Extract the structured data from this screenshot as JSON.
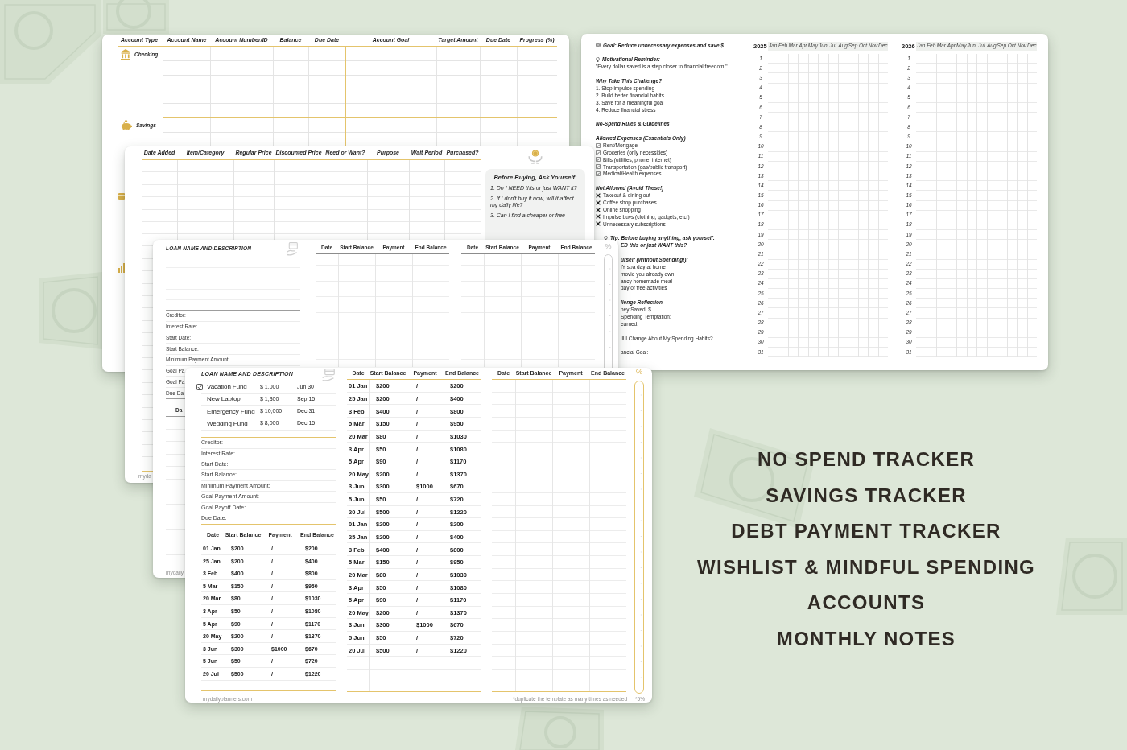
{
  "accounts_page": {
    "columns": [
      "Account Type",
      "Account Name",
      "Account Number/ID",
      "Balance",
      "Due Date",
      "Account Goal",
      "Target Amount",
      "Due Date",
      "Progress (%)"
    ],
    "account_types": [
      {
        "label": "Checking"
      },
      {
        "label": "Savings"
      }
    ]
  },
  "no_spend_page": {
    "notes": [
      [
        {
          "kind": "goal",
          "text": "Goal: Reduce unnecessary expenses and save $"
        }
      ],
      [
        {
          "kind": "reminder",
          "text": "Motivational Reminder:"
        },
        {
          "kind": "text",
          "text": "\"Every dollar saved is a step closer to financial freedom.\""
        }
      ],
      [
        {
          "kind": "heading",
          "text": "Why Take This Challenge?"
        },
        {
          "kind": "text",
          "text": "1. Stop impulse spending"
        },
        {
          "kind": "text",
          "text": "2. Build better financial habits"
        },
        {
          "kind": "text",
          "text": "3. Save for a meaningful goal"
        },
        {
          "kind": "text",
          "text": "4. Reduce financial stress"
        }
      ],
      [
        {
          "kind": "heading",
          "text": "No-Spend Rules & Guidelines"
        }
      ],
      [
        {
          "kind": "heading",
          "text": "Allowed Expenses (Essentials Only)"
        },
        {
          "kind": "allowed",
          "text": "Rent/Mortgage"
        },
        {
          "kind": "allowed",
          "text": "Groceries (only necessities)"
        },
        {
          "kind": "allowed",
          "text": "Bills (utilities, phone, internet)"
        },
        {
          "kind": "allowed",
          "text": "Transportation (gas/public transport)"
        },
        {
          "kind": "allowed",
          "text": "Medical/Health expenses"
        }
      ],
      [
        {
          "kind": "heading",
          "text": "Not Allowed (Avoid These!)"
        },
        {
          "kind": "banned",
          "text": "Takeout & dining out"
        },
        {
          "kind": "banned",
          "text": "Coffee shop purchases"
        },
        {
          "kind": "banned",
          "text": "Online shopping"
        },
        {
          "kind": "banned",
          "text": "Impulse buys (clothing, gadgets, etc.)"
        },
        {
          "kind": "banned",
          "text": "Unnecessary subscriptions"
        }
      ],
      [
        {
          "kind": "tip",
          "text": "Tip: Before buying anything, ask yourself:"
        }
      ]
    ],
    "notes_partly_covered": [
      [
        {
          "kind": "heading",
          "text": "ED this or just WANT this?"
        }
      ],
      [
        {
          "kind": "heading",
          "text": "urself (Without Spending!):"
        },
        {
          "kind": "text",
          "text": "IY spa day at home"
        },
        {
          "kind": "text",
          "text": "movie you already own"
        },
        {
          "kind": "text",
          "text": "ancy homemade meal"
        },
        {
          "kind": "text",
          "text": "day of free activities"
        }
      ],
      [
        {
          "kind": "heading",
          "text": "llenge Reflection"
        },
        {
          "kind": "text",
          "text": "ney Saved: $"
        },
        {
          "kind": "text",
          "text": "Spending Temptation:"
        },
        {
          "kind": "text",
          "text": "earned:"
        }
      ],
      [
        {
          "kind": "text",
          "text": "ill I Change About My Spending Habits?"
        }
      ],
      [
        {
          "kind": "text",
          "text": "ancial Goal:"
        }
      ]
    ],
    "trackers": [
      {
        "year": "2025",
        "months": [
          "Jan",
          "Feb",
          "Mar",
          "Apr",
          "May",
          "Jun",
          "Jul",
          "Aug",
          "Sep",
          "Oct",
          "Nov",
          "Dec"
        ],
        "days": [
          "1",
          "2",
          "3",
          "4",
          "5",
          "6",
          "7",
          "8",
          "9",
          "10",
          "11",
          "12",
          "13",
          "14",
          "15",
          "16",
          "17",
          "18",
          "19",
          "20",
          "21",
          "22",
          "23",
          "24",
          "25",
          "26",
          "27",
          "28",
          "29",
          "30",
          "31"
        ]
      },
      {
        "year": "2026",
        "months": [
          "Jan",
          "Feb",
          "Mar",
          "Apr",
          "May",
          "Jun",
          "Jul",
          "Aug",
          "Sep",
          "Oct",
          "Nov",
          "Dec"
        ],
        "days": [
          "1",
          "2",
          "3",
          "4",
          "5",
          "6",
          "7",
          "8",
          "9",
          "10",
          "11",
          "12",
          "13",
          "14",
          "15",
          "16",
          "17",
          "18",
          "19",
          "20",
          "21",
          "22",
          "23",
          "24",
          "25",
          "26",
          "27",
          "28",
          "29",
          "30",
          "31"
        ]
      }
    ]
  },
  "wishlist_page": {
    "columns": [
      "Date Added",
      "Item/Category",
      "Regular Price",
      "Discounted Price",
      "Need or Want?",
      "Purpose",
      "Wait Period",
      "Purchased?"
    ],
    "reminder_card": {
      "title": "Before Buying, Ask Yourself:",
      "questions": [
        "1. Do I NEED this or just WANT it?",
        "2. If I don't buy it now, will it affect my daily life?",
        "3. Can I find a cheaper or free"
      ]
    },
    "footer": "myda"
  },
  "loan_page_back": {
    "title": "LOAN NAME AND DESCRIPTION",
    "fields": [
      "Creditor:",
      "Interest Rate:",
      "Start Date:",
      "Start Balance:",
      "Minimum Payment Amount:",
      "Goal Pa",
      "Goal Pa",
      "Due Da"
    ],
    "history_columns": [
      "Da"
    ],
    "tables": [
      {
        "columns": [
          "Date",
          "Start Balance",
          "Payment",
          "End Balance"
        ]
      },
      {
        "columns": [
          "Date",
          "Start Balance",
          "Payment",
          "End Balance"
        ]
      }
    ],
    "progress_symbol": "%",
    "footer": "mydaily"
  },
  "loan_page_front": {
    "title": "LOAN NAME AND DESCRIPTION",
    "goals": [
      {
        "checked": true,
        "name": "Vacation Fund",
        "amount": "$ 1,000",
        "date": "Jun 30"
      },
      {
        "checked": false,
        "name": "New Laptop",
        "amount": "$ 1,300",
        "date": "Sep 15"
      },
      {
        "checked": false,
        "name": "Emergency Fund",
        "amount": "$ 10,000",
        "date": "Dec 31"
      },
      {
        "checked": false,
        "name": "Wedding Fund",
        "amount": "$ 8,000",
        "date": "Dec 15"
      }
    ],
    "fields": [
      "Creditor:",
      "Interest Rate:",
      "Start Date:",
      "Start Balance:",
      "Minimum Payment Amount:",
      "Goal Payment Amount:",
      "Goal Payoff Date:",
      "Due Date:"
    ],
    "history": {
      "columns": [
        "Date",
        "Start Balance",
        "Payment",
        "End Balance"
      ],
      "rows": [
        [
          "01 Jan",
          "$200",
          "/",
          "$200"
        ],
        [
          "25 Jan",
          "$200",
          "/",
          "$400"
        ],
        [
          "3 Feb",
          "$400",
          "/",
          "$800"
        ],
        [
          "5 Mar",
          "$150",
          "/",
          "$950"
        ],
        [
          "20 Mar",
          "$80",
          "/",
          "$1030"
        ],
        [
          "3 Apr",
          "$50",
          "/",
          "$1080"
        ],
        [
          "5 Apr",
          "$90",
          "/",
          "$1170"
        ],
        [
          "20 May",
          "$200",
          "/",
          "$1370"
        ],
        [
          "3 Jun",
          "$300",
          "$1000",
          "$670"
        ],
        [
          "5 Jun",
          "$50",
          "/",
          "$720"
        ],
        [
          "20 Jul",
          "$500",
          "/",
          "$1220"
        ]
      ]
    },
    "tables": [
      {
        "columns": [
          "Date",
          "Start Balance",
          "Payment",
          "End Balance"
        ],
        "rows": [
          [
            "01 Jan",
            "$200",
            "/",
            "$200"
          ],
          [
            "25 Jan",
            "$200",
            "/",
            "$400"
          ],
          [
            "3 Feb",
            "$400",
            "/",
            "$800"
          ],
          [
            "5 Mar",
            "$150",
            "/",
            "$950"
          ],
          [
            "20 Mar",
            "$80",
            "/",
            "$1030"
          ],
          [
            "3 Apr",
            "$50",
            "/",
            "$1080"
          ],
          [
            "5 Apr",
            "$90",
            "/",
            "$1170"
          ],
          [
            "20 May",
            "$200",
            "/",
            "$1370"
          ],
          [
            "3 Jun",
            "$300",
            "$1000",
            "$670"
          ],
          [
            "5 Jun",
            "$50",
            "/",
            "$720"
          ],
          [
            "20 Jul",
            "$500",
            "/",
            "$1220"
          ],
          [
            "01 Jan",
            "$200",
            "/",
            "$200"
          ],
          [
            "25 Jan",
            "$200",
            "/",
            "$400"
          ],
          [
            "3 Feb",
            "$400",
            "/",
            "$800"
          ],
          [
            "5 Mar",
            "$150",
            "/",
            "$950"
          ],
          [
            "20 Mar",
            "$80",
            "/",
            "$1030"
          ],
          [
            "3 Apr",
            "$50",
            "/",
            "$1080"
          ],
          [
            "5 Apr",
            "$90",
            "/",
            "$1170"
          ],
          [
            "20 May",
            "$200",
            "/",
            "$1370"
          ],
          [
            "3 Jun",
            "$300",
            "$1000",
            "$670"
          ],
          [
            "5 Jun",
            "$50",
            "/",
            "$720"
          ],
          [
            "20 Jul",
            "$500",
            "/",
            "$1220"
          ]
        ]
      },
      {
        "columns": [
          "Date",
          "Start Balance",
          "Payment",
          "End Balance"
        ]
      }
    ],
    "progress_symbol": "%",
    "footer": "mydailyplanners.com",
    "note": "*duplicate the template as many times as needed",
    "page_mark": "*5%"
  },
  "features": [
    "NO SPEND TRACKER",
    "SAVINGS TRACKER",
    "DEBT PAYMENT TRACKER",
    "WISHLIST & MINDFUL SPENDING",
    "ACCOUNTS",
    "MONTHLY NOTES"
  ]
}
